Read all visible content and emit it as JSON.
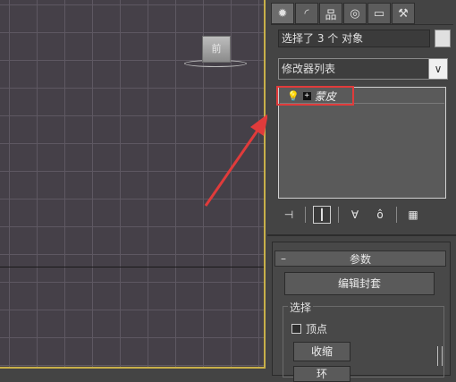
{
  "viewport": {
    "viewcube_label": "前"
  },
  "panel": {
    "tabs": [
      {
        "icon": "create-icon",
        "glyph": "✹"
      },
      {
        "icon": "modify-icon",
        "glyph": "◜"
      },
      {
        "icon": "hierarchy-icon",
        "glyph": "品"
      },
      {
        "icon": "motion-icon",
        "glyph": "◎"
      },
      {
        "icon": "display-icon",
        "glyph": "▭"
      },
      {
        "icon": "utilities-icon",
        "glyph": "⚒"
      }
    ],
    "selection_text": "选择了 3 个 对象",
    "modifier_list_label": "修改器列表",
    "dropdown_glyph": "∨",
    "stack_item_label": "蒙皮",
    "stack_tools": [
      {
        "icon": "pin-stack-icon",
        "glyph": "⊣"
      },
      {
        "icon": "show-end-result-icon",
        "glyph": "┃"
      },
      {
        "icon": "make-unique-icon",
        "glyph": "∀"
      },
      {
        "icon": "remove-modifier-icon",
        "glyph": "ô"
      },
      {
        "icon": "configure-sets-icon",
        "glyph": "▦"
      }
    ]
  },
  "parameters": {
    "collapse_glyph": "–",
    "title": "参数",
    "edit_envelopes_label": "编辑封套",
    "selection_group_label": "选择",
    "vertices_label": "顶点",
    "vertices_checked": false,
    "shrink_label": "收缩",
    "ring_label": "环"
  },
  "colors": {
    "active_border": "#c8b04a",
    "highlight": "#e03b3b",
    "arrow": "#e03b3b"
  }
}
